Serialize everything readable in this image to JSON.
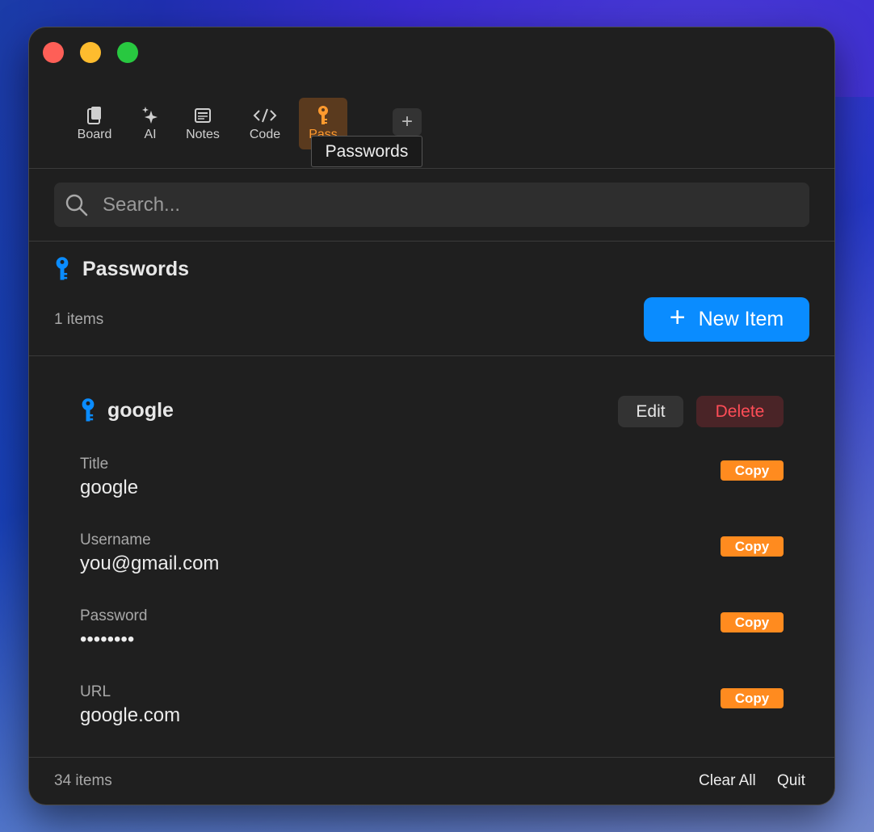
{
  "tabs": [
    {
      "label": "Board",
      "icon": "clipboard-icon"
    },
    {
      "label": "AI",
      "icon": "sparkles-icon"
    },
    {
      "label": "Notes",
      "icon": "notes-icon"
    },
    {
      "label": "Code",
      "icon": "code-icon"
    },
    {
      "label": "Pass",
      "icon": "key-icon",
      "active": true
    }
  ],
  "add_tab_label": "+",
  "tooltip": "Passwords",
  "search": {
    "placeholder": "Search..."
  },
  "section": {
    "title": "Passwords",
    "count": "1 items",
    "new_item_label": "New Item"
  },
  "item": {
    "name": "google",
    "edit_label": "Edit",
    "delete_label": "Delete",
    "fields": [
      {
        "label": "Title",
        "value": "google",
        "copy": "Copy"
      },
      {
        "label": "Username",
        "value": "you@gmail.com",
        "copy": "Copy"
      },
      {
        "label": "Password",
        "value": "••••••••",
        "copy": "Copy"
      },
      {
        "label": "URL",
        "value": "google.com",
        "copy": "Copy"
      }
    ]
  },
  "footer": {
    "count": "34 items",
    "clear_all": "Clear All",
    "quit": "Quit"
  },
  "colors": {
    "accent": "#0a8cff",
    "active_tab": "#ff9a2e",
    "copy": "#ff8b1f",
    "delete": "#ff4d57"
  }
}
